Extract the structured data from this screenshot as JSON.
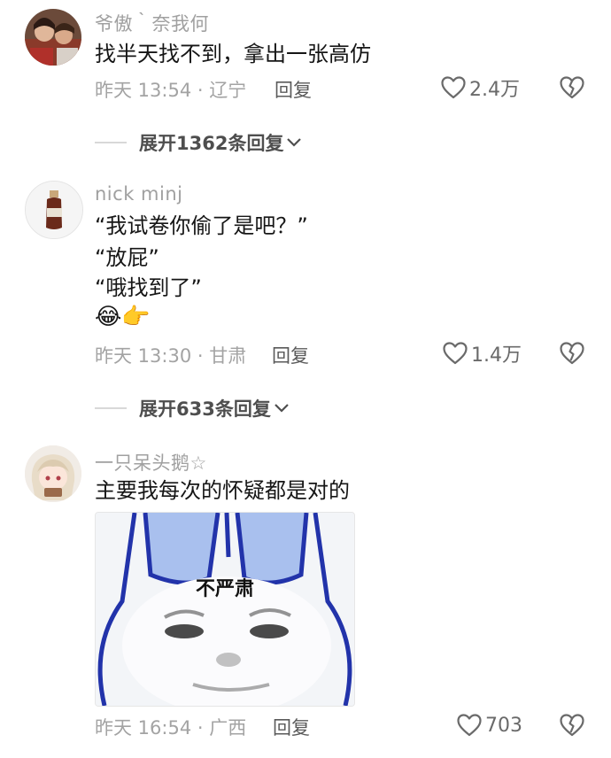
{
  "comments": [
    {
      "username": "爷傲｀奈我何",
      "lines": [
        "找半天找不到，拿出一张高仿"
      ],
      "meta": "昨天 13:54 · 辽宁",
      "reply_label": "回复",
      "likes": "2.4万",
      "expand_label": "展开1362条回复"
    },
    {
      "username": "nick minj",
      "lines": [
        "“我试卷你偷了是吧？”",
        "“放屁”",
        "“哦找到了”"
      ],
      "emoji": [
        "😂",
        "👉"
      ],
      "meta": "昨天 13:30 · 甘肃",
      "reply_label": "回复",
      "likes": "1.4万",
      "expand_label": "展开633条回复"
    },
    {
      "username": "一只呆头鹅☆",
      "lines": [
        "主要我每次的怀疑都是对的"
      ],
      "image_caption": "不严肃",
      "meta": "昨天 16:54 · 广西",
      "reply_label": "回复",
      "likes": "703"
    }
  ],
  "icons": {
    "like": "heart-outline-icon",
    "dislike": "broken-heart-icon",
    "expand": "chevron-down-icon"
  },
  "colors": {
    "text_primary": "#161616",
    "text_secondary": "#a0a0a0",
    "icon": "#6a6a6a"
  }
}
